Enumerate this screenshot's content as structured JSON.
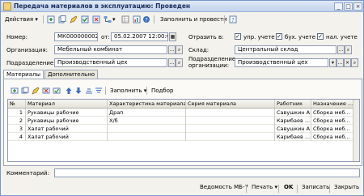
{
  "window": {
    "title": "Передача материалов в эксплуатацию: Проведен",
    "minimize": "_",
    "maximize": "□",
    "close": "×"
  },
  "toolbar": {
    "actions": "Действия",
    "fill_and_post": "Заполнить и провести"
  },
  "header": {
    "number_label": "Номер:",
    "number_value": "МК000000002",
    "from_label": "от:",
    "date_value": "05.02.2007 12:00:01",
    "reflect_label": "Отразить в:",
    "upr_label": "упр. учете",
    "buh_label": "бух. учете",
    "nal_label": "нал. учете",
    "checks": {
      "upr": true,
      "buh": true,
      "nal": true
    },
    "org_label": "Организация:",
    "org_value": "Мебельный комбинат",
    "warehouse_label": "Склад:",
    "warehouse_value": "Центральный склад",
    "dept_label": "Подразделение:",
    "dept_value": "Производственный цех",
    "orgdept_label_1": "Подразделение",
    "orgdept_label_2": "организации:",
    "orgdept_value": "Производственный цех"
  },
  "tabs": [
    {
      "label": "Материалы"
    },
    {
      "label": "Дополнительно"
    }
  ],
  "table_toolbar": {
    "fill": "Заполнить",
    "select": "Подбор"
  },
  "table": {
    "columns": [
      "№",
      "Материал",
      "Характеристика материала",
      "Серия материала",
      "Работник",
      "Назначение ..."
    ],
    "rows": [
      [
        "1",
        "Рукавицы рабочие",
        "Драп",
        "",
        "Савушкин А...",
        "Сборка меб..."
      ],
      [
        "2",
        "Рукавицы рабочие",
        "Х/б",
        "",
        "Карибаев ...",
        "Сборка меб..."
      ],
      [
        "3",
        "Халат рабочий",
        "",
        "",
        "Савушкин А...",
        "Сборка меб..."
      ],
      [
        "4",
        "Халат рабочий",
        "",
        "",
        "Карибаев ...",
        "Сборка меб..."
      ]
    ]
  },
  "comment": {
    "label": "Комментарий:",
    "value": ""
  },
  "footer": {
    "report": "Ведомость МБ-7",
    "print": "Печать",
    "ok": "OK",
    "save": "Записать",
    "close": "Закрыть"
  },
  "colors": {
    "title_text": "#1c2d57",
    "window_bg": "#f3f2ec",
    "border": "#7a96c8"
  }
}
